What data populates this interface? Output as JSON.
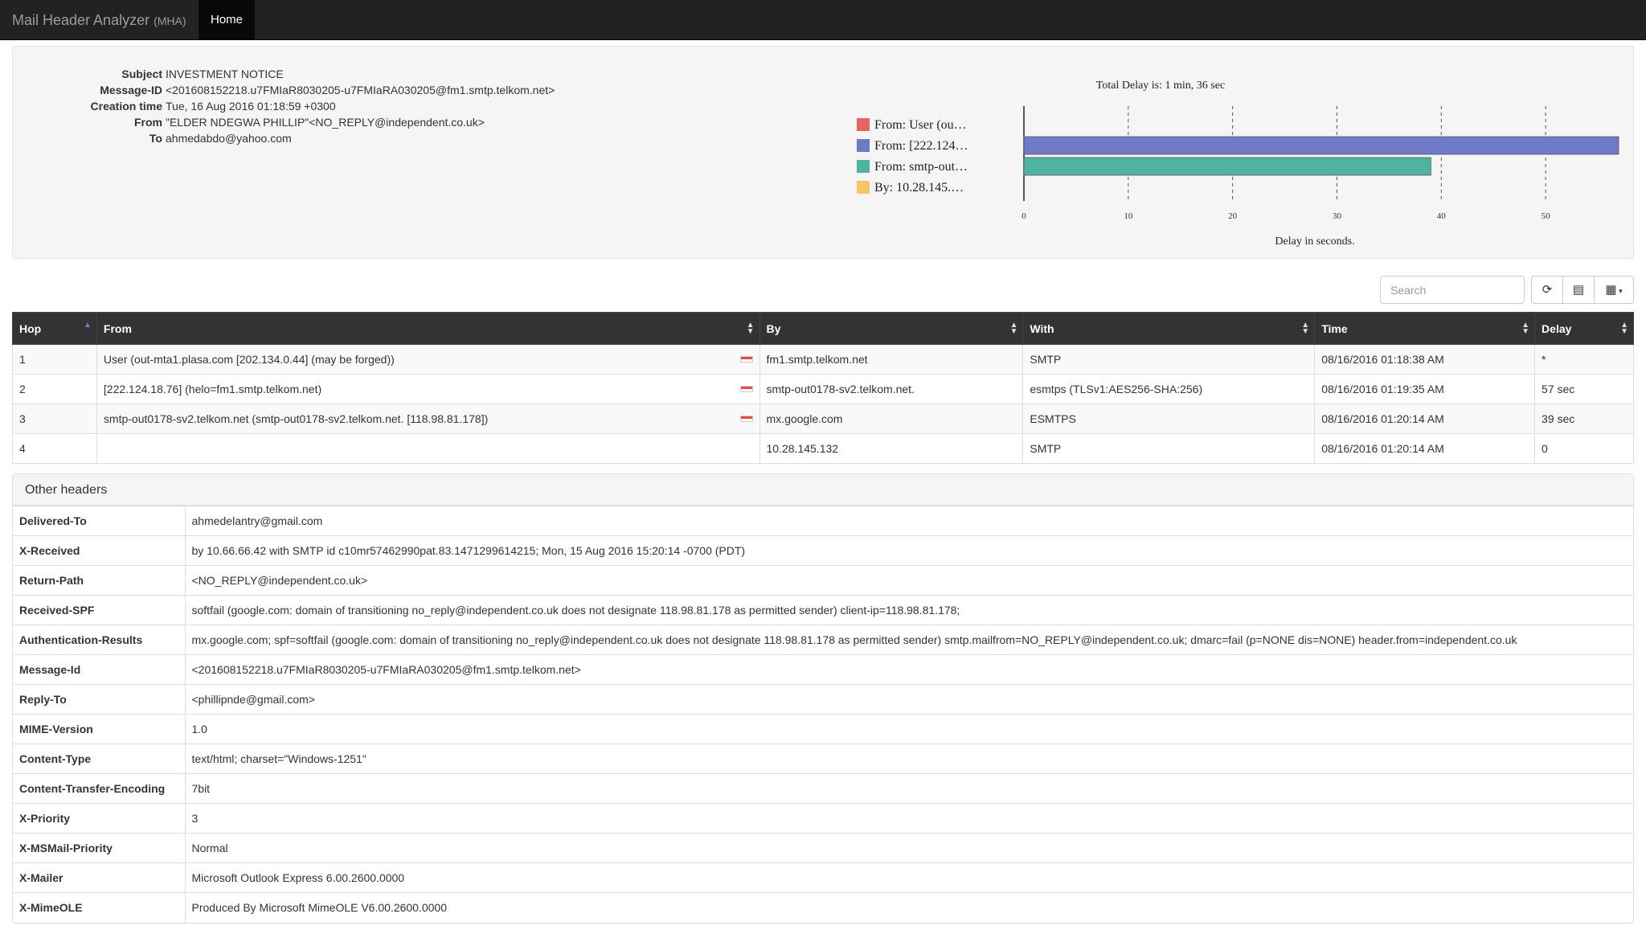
{
  "navbar": {
    "brand": "Mail Header Analyzer",
    "brand_small": "(MHA)",
    "home": "Home"
  },
  "summary": [
    {
      "key": "Subject",
      "value": "INVESTMENT NOTICE"
    },
    {
      "key": "Message-ID",
      "value": "<201608152218.u7FMIaR8030205-u7FMIaRA030205@fm1.smtp.telkom.net>"
    },
    {
      "key": "Creation time",
      "value": "Tue, 16 Aug 2016 01:18:59 +0300"
    },
    {
      "key": "From",
      "value": "\"ELDER NDEGWA PHILLIP\"<NO_REPLY@independent.co.uk>"
    },
    {
      "key": "To",
      "value": "ahmedabdo@yahoo.com"
    }
  ],
  "chart_data": {
    "type": "bar",
    "orientation": "horizontal",
    "title": "Total Delay is: 1 min, 36 sec",
    "xlabel": "Delay in seconds.",
    "xlim": [
      0,
      57
    ],
    "xticks": [
      0,
      10,
      20,
      30,
      40,
      50
    ],
    "grid": "dashed vertical",
    "legend": "left",
    "series": [
      {
        "name": "From: User (ou…",
        "value": 0,
        "color": "#e8625f"
      },
      {
        "name": "From: [222.124…",
        "value": 57,
        "color": "#7079c8"
      },
      {
        "name": "From: smtp-out…",
        "value": 39,
        "color": "#4fb3a1"
      },
      {
        "name": "By: 10.28.145.…",
        "value": 0,
        "color": "#f7c564"
      }
    ]
  },
  "toolbar": {
    "search_placeholder": "Search"
  },
  "hops": {
    "columns": [
      "Hop",
      "From",
      "By",
      "With",
      "Time",
      "Delay"
    ],
    "rows": [
      {
        "hop": "1",
        "from": "User (out-mta1.plasa.com [202.134.0.44] (may be forged))",
        "flag": true,
        "by": "fm1.smtp.telkom.net",
        "with": "SMTP",
        "time": "08/16/2016 01:18:38 AM",
        "delay": "*"
      },
      {
        "hop": "2",
        "from": "[222.124.18.76] (helo=fm1.smtp.telkom.net)",
        "flag": true,
        "by": "smtp-out0178-sv2.telkom.net.",
        "with": "esmtps (TLSv1:AES256-SHA:256)",
        "time": "08/16/2016 01:19:35 AM",
        "delay": "57 sec"
      },
      {
        "hop": "3",
        "from": "smtp-out0178-sv2.telkom.net (smtp-out0178-sv2.telkom.net. [118.98.81.178])",
        "flag": true,
        "by": "mx.google.com",
        "with": "ESMTPS",
        "time": "08/16/2016 01:20:14 AM",
        "delay": "39 sec"
      },
      {
        "hop": "4",
        "from": "",
        "flag": false,
        "by": "10.28.145.132",
        "with": "SMTP",
        "time": "08/16/2016 01:20:14 AM",
        "delay": "0"
      }
    ]
  },
  "other_headers": {
    "title": "Other headers",
    "rows": [
      {
        "key": "Delivered-To",
        "value": "ahmedelantry@gmail.com"
      },
      {
        "key": "X-Received",
        "value": "by 10.66.66.42 with SMTP id c10mr57462990pat.83.1471299614215; Mon, 15 Aug 2016 15:20:14 -0700 (PDT)"
      },
      {
        "key": "Return-Path",
        "value": "<NO_REPLY@independent.co.uk>"
      },
      {
        "key": "Received-SPF",
        "value": "softfail (google.com: domain of transitioning no_reply@independent.co.uk does not designate 118.98.81.178 as permitted sender) client-ip=118.98.81.178;"
      },
      {
        "key": "Authentication-Results",
        "value": "mx.google.com; spf=softfail (google.com: domain of transitioning no_reply@independent.co.uk does not designate 118.98.81.178 as permitted sender) smtp.mailfrom=NO_REPLY@independent.co.uk; dmarc=fail (p=NONE dis=NONE) header.from=independent.co.uk"
      },
      {
        "key": "Message-Id",
        "value": "<201608152218.u7FMIaR8030205-u7FMIaRA030205@fm1.smtp.telkom.net>"
      },
      {
        "key": "Reply-To",
        "value": "<phillipnde@gmail.com>"
      },
      {
        "key": "MIME-Version",
        "value": "1.0"
      },
      {
        "key": "Content-Type",
        "value": "text/html; charset=\"Windows-1251\""
      },
      {
        "key": "Content-Transfer-Encoding",
        "value": "7bit"
      },
      {
        "key": "X-Priority",
        "value": "3"
      },
      {
        "key": "X-MSMail-Priority",
        "value": "Normal"
      },
      {
        "key": "X-Mailer",
        "value": "Microsoft Outlook Express 6.00.2600.0000"
      },
      {
        "key": "X-MimeOLE",
        "value": "Produced By Microsoft MimeOLE V6.00.2600.0000"
      }
    ]
  }
}
